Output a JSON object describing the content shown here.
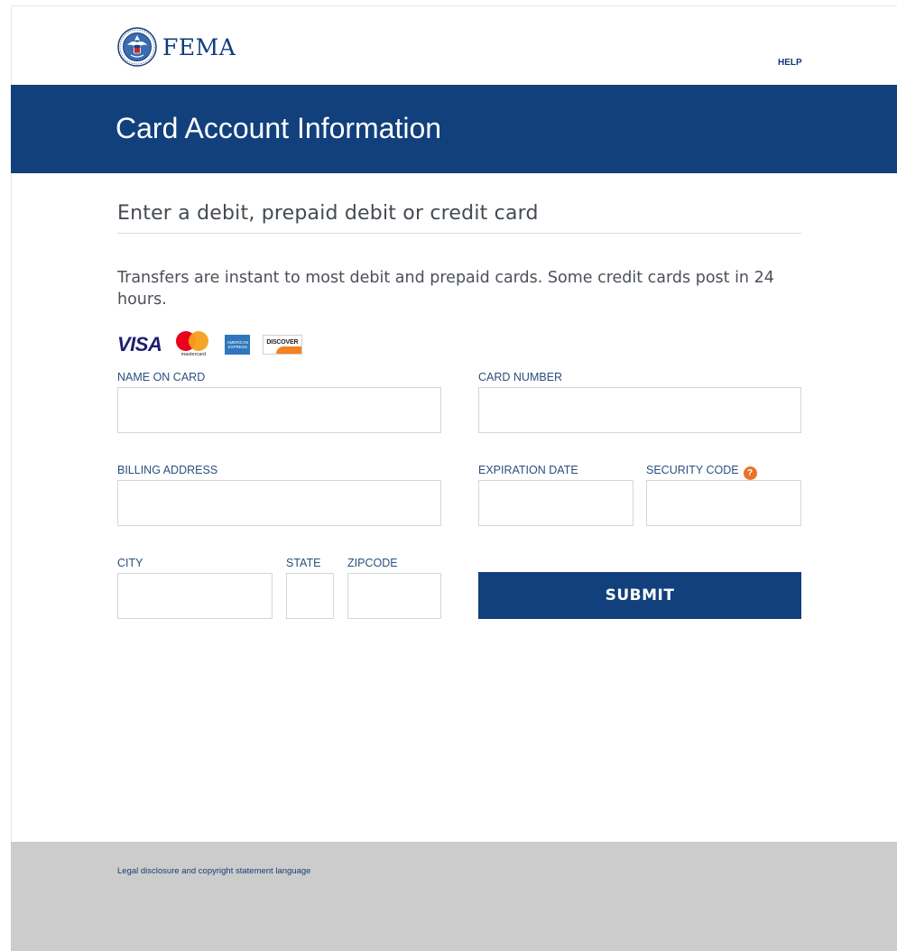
{
  "header": {
    "logo_text": "FEMA",
    "help_label": "HELP"
  },
  "banner": {
    "title": "Card Account Information"
  },
  "form": {
    "subtitle": "Enter a debit, prepaid debit or credit card",
    "description": "Transfers are instant to most debit and prepaid cards. Some credit cards post in 24 hours.",
    "card_logos": {
      "visa": "VISA",
      "mastercard": "mastercard",
      "amex": "AMERICAN EXPRESS",
      "discover": "DISCOVER"
    },
    "fields": {
      "name_on_card": {
        "label": "NAME ON CARD",
        "value": ""
      },
      "card_number": {
        "label": "CARD NUMBER",
        "value": ""
      },
      "billing_address": {
        "label": "BILLING ADDRESS",
        "value": ""
      },
      "expiration_date": {
        "label": "EXPIRATION DATE",
        "value": ""
      },
      "security_code": {
        "label": "SECURITY CODE",
        "value": "",
        "help_icon": "?"
      },
      "city": {
        "label": "CITY",
        "value": ""
      },
      "state": {
        "label": "STATE",
        "value": ""
      },
      "zipcode": {
        "label": "ZIPCODE",
        "value": ""
      }
    },
    "submit_label": "SUBMIT"
  },
  "footer": {
    "legal_text": "Legal disclosure and copyright statement language"
  },
  "colors": {
    "brand_blue": "#11407d",
    "label_blue": "#2a4f7f",
    "help_orange": "#e8732a",
    "footer_gray": "#cccccc"
  }
}
